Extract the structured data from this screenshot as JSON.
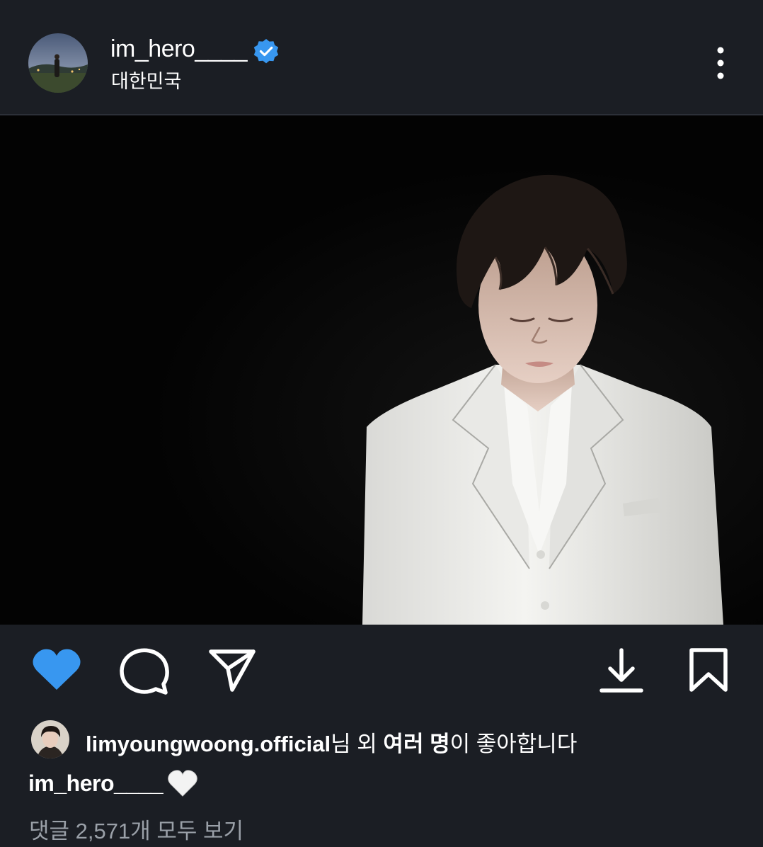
{
  "post": {
    "username": "im_hero____",
    "location": "대한민국",
    "verified": true,
    "accent_color": "#3897f0"
  },
  "likes": {
    "liker": "limyoungwoong.official",
    "suffix_before": "님 외 ",
    "others": "여러 명",
    "suffix_after": "이 좋아합니다"
  },
  "caption": {
    "username": "im_hero____",
    "emoji": "white-heart"
  },
  "comments": {
    "view_all": "댓글 2,571개 모두 보기"
  },
  "icons": {
    "like": "heart-icon",
    "comment": "comment-icon",
    "share": "send-icon",
    "download": "download-icon",
    "save": "bookmark-icon",
    "more": "more-vertical-icon"
  },
  "theme": {
    "background": "#1b1e24",
    "photo_background": "#030303",
    "secondary_text": "#9aa0a8"
  }
}
